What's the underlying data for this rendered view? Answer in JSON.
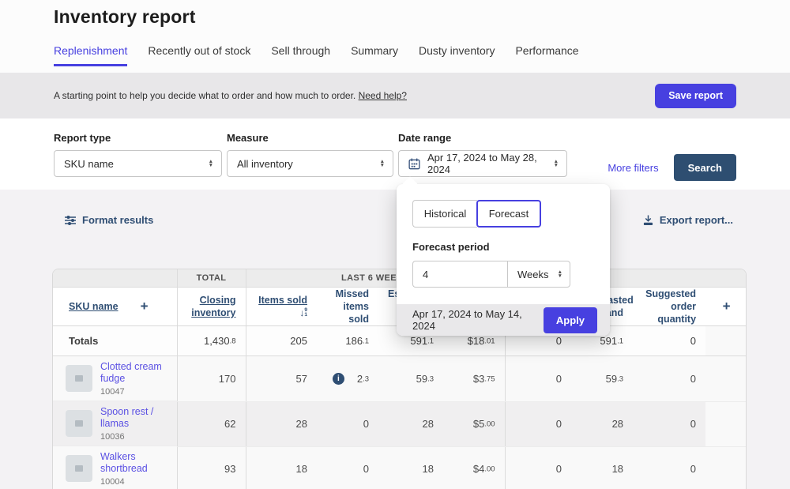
{
  "page_title": "Inventory report",
  "tabs": {
    "items": [
      "Replenishment",
      "Recently out of stock",
      "Sell through",
      "Summary",
      "Dusty inventory",
      "Performance"
    ],
    "active": "Replenishment"
  },
  "banner": {
    "text": "A starting point to help you decide what to order and how much to order.",
    "help_link": "Need help?",
    "save_button": "Save report"
  },
  "filters": {
    "report_type": {
      "label": "Report type",
      "value": "SKU name"
    },
    "measure": {
      "label": "Measure",
      "value": "All inventory"
    },
    "date_range": {
      "label": "Date range",
      "value": "Apr 17, 2024 to May 28, 2024"
    },
    "more_filters": "More filters",
    "search_button": "Search"
  },
  "popover": {
    "historical_tab": "Historical",
    "forecast_tab": "Forecast",
    "selected": "Forecast",
    "period_label": "Forecast period",
    "period_value": "4",
    "period_unit": "Weeks",
    "range_preview": "Apr 17, 2024 to May 14, 2024",
    "apply_button": "Apply"
  },
  "toolbar": {
    "format_results": "Format results",
    "export_report": "Export report..."
  },
  "table": {
    "group_headers": {
      "total": "TOTAL",
      "last_6_weeks": "LAST 6 WEEKS"
    },
    "columns": {
      "sku": "SKU name",
      "closing_inventory": "Closing inventory",
      "items_sold": "Items sold",
      "missed_items_sold": "Missed items sold",
      "estimated_items_sold": "Estimated items sold",
      "hidden_col_1": "",
      "hidden_col_2": "",
      "forecasted_demand": "Forecasted demand",
      "suggested_order_quantity": "Suggested order quantity"
    },
    "totals": {
      "label": "Totals",
      "closing": "1,430.8",
      "items_sold": "205",
      "missed": "186.1",
      "estimated": "591.1",
      "price": "$18.01",
      "col7": "0",
      "forecast": "591.1",
      "suggested": "0"
    },
    "rows": [
      {
        "name": "Clotted cream fudge",
        "sku": "10047",
        "closing": "170",
        "items_sold": "57",
        "missed": "2.3",
        "estimated": "59.3",
        "price": "$3.75",
        "col7": "0",
        "forecast": "59.3",
        "suggested": "0"
      },
      {
        "name": "Spoon rest / llamas",
        "sku": "10036",
        "closing": "62",
        "items_sold": "28",
        "missed": "0",
        "estimated": "28",
        "price": "$5.00",
        "col7": "0",
        "forecast": "28",
        "suggested": "0"
      },
      {
        "name": "Walkers shortbread",
        "sku": "10004",
        "closing": "93",
        "items_sold": "18",
        "missed": "0",
        "estimated": "18",
        "price": "$4.00",
        "col7": "0",
        "forecast": "18",
        "suggested": "0"
      }
    ]
  },
  "colors": {
    "accent": "#4740e0",
    "navy": "#2e4e71"
  }
}
